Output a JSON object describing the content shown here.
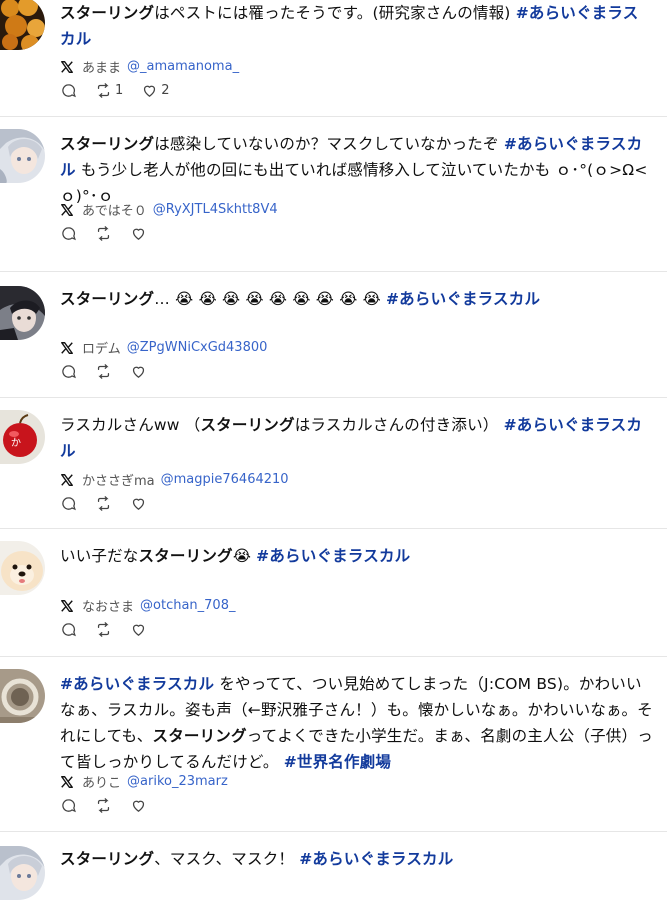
{
  "posts": [
    {
      "segments": [
        {
          "t": "b",
          "v": "スターリング"
        },
        {
          "t": "n",
          "v": "はペストには罹ったそうです。(研究家さんの情報) "
        },
        {
          "t": "tag",
          "v": "#あらいぐまラスカル"
        }
      ],
      "author": "あまま",
      "handle": "@_amamanoma_",
      "retweets": "1",
      "likes": "2",
      "avatar": "food"
    },
    {
      "segments": [
        {
          "t": "b",
          "v": "スターリング"
        },
        {
          "t": "n",
          "v": "は感染していないのか？マスクしていなかったぞ "
        },
        {
          "t": "tag",
          "v": "#あらいぐまラスカル"
        },
        {
          "t": "n",
          "v": " もう少し老人が他の回にも出ていれば感情移入して泣いていたかも ｏ･°(ｏ>Ω<ｏ)°･ｏ"
        }
      ],
      "author": "あではそ０",
      "handle": "@RyXJTL4Skhtt8V4",
      "retweets": "",
      "likes": "",
      "avatar": "anime-silver"
    },
    {
      "segments": [
        {
          "t": "b",
          "v": "スターリング"
        },
        {
          "t": "n",
          "v": "… 😭 😭 😭 😭 😭 😭 😭 😭 😭 "
        },
        {
          "t": "tag",
          "v": "#あらいぐまラスカル"
        }
      ],
      "author": "ロデム",
      "handle": "@ZPgWNiCxGd43800",
      "retweets": "",
      "likes": "",
      "avatar": "anime-dark"
    },
    {
      "segments": [
        {
          "t": "n",
          "v": "ラスカルさんww （"
        },
        {
          "t": "b",
          "v": "スターリング"
        },
        {
          "t": "n",
          "v": "はラスカルさんの付き添い） "
        },
        {
          "t": "tag",
          "v": "#あらいぐまラスカル"
        }
      ],
      "author": "かささぎma",
      "handle": "@magpie76464210",
      "retweets": "",
      "likes": "",
      "avatar": "apple"
    },
    {
      "segments": [
        {
          "t": "n",
          "v": "いい子だな"
        },
        {
          "t": "b",
          "v": "スターリング"
        },
        {
          "t": "n",
          "v": "😭 "
        },
        {
          "t": "tag",
          "v": "#あらいぐまラスカル"
        }
      ],
      "author": "なおさま",
      "handle": "@otchan_708_",
      "retweets": "",
      "likes": "",
      "avatar": "dog"
    },
    {
      "segments": [
        {
          "t": "tag",
          "v": "#あらいぐまラスカル"
        },
        {
          "t": "n",
          "v": " をやってて、つい見始めてしまった（J:COM BS)。かわいいなぁ、ラスカル。姿も声（←野沢雅子さん！）も。懐かしいなぁ。かわいいなぁ。それにしても、"
        },
        {
          "t": "b",
          "v": "スターリング"
        },
        {
          "t": "n",
          "v": "ってよくできた小学生だ。まぁ、名劇の主人公（子供）って皆しっかりしてるんだけど。 "
        },
        {
          "t": "tag",
          "v": "#世界名作劇場"
        }
      ],
      "author": "ありこ",
      "handle": "@ariko_23marz",
      "retweets": "",
      "likes": "",
      "avatar": "ring"
    },
    {
      "segments": [
        {
          "t": "b",
          "v": "スターリング"
        },
        {
          "t": "n",
          "v": "、マスク、マスク！ "
        },
        {
          "t": "tag",
          "v": "#あらいぐまラスカル"
        }
      ],
      "author": "",
      "handle": "",
      "retweets": "",
      "likes": "",
      "avatar": "anime-silver"
    }
  ]
}
